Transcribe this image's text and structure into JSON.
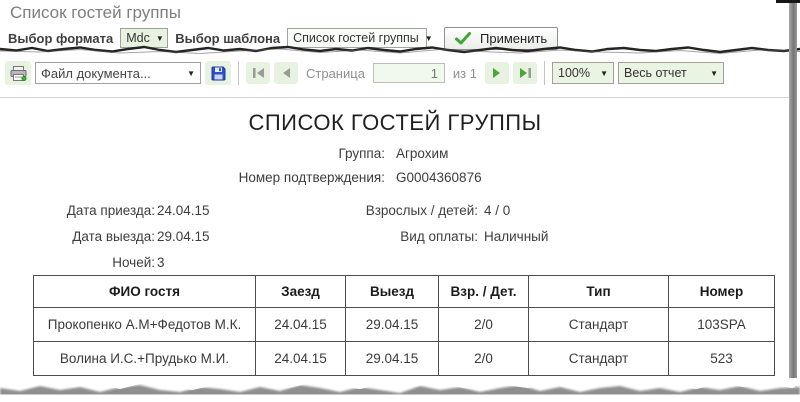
{
  "page": {
    "title": "Список гостей группы"
  },
  "format_bar": {
    "format_label": "Выбор формата",
    "format_value": "Mdc",
    "template_label": "Выбор шаблона",
    "template_value": "Список гостей группы",
    "apply_label": "Применить"
  },
  "toolbar": {
    "file_menu_value": "Файл документа...",
    "page_label": "Страница",
    "page_value": "1",
    "page_total": "из 1",
    "zoom_value": "100%",
    "view_value": "Весь отчет"
  },
  "report": {
    "title": "СПИСОК ГОСТЕЙ ГРУППЫ",
    "fields": {
      "group_label": "Группа:",
      "group_value": "Агрохим",
      "confirmation_label": "Номер подтверждения:",
      "confirmation_value": "G0004360876",
      "arrival_label": "Дата приезда:",
      "arrival_value": "24.04.15",
      "departure_label": "Дата выезда:",
      "departure_value": "29.04.15",
      "nights_label": "Ночей:",
      "nights_value": "3",
      "adults_label": "Взрослых / детей:",
      "adults_value": "4 / 0",
      "payment_label": "Вид оплаты:",
      "payment_value": "Наличный"
    },
    "table": {
      "headers": [
        "ФИО гостя",
        "Заезд",
        "Выезд",
        "Взр. / Дет.",
        "Тип",
        "Номер"
      ],
      "rows": [
        [
          "Прокопенко А.М+Федотов М.К.",
          "24.04.15",
          "29.04.15",
          "2/0",
          "Стандарт",
          "103SPA"
        ],
        [
          "Волина И.С.+Прудько М.И.",
          "24.04.15",
          "29.04.15",
          "2/0",
          "Стандарт",
          "523"
        ]
      ]
    }
  },
  "icons": {
    "printer": "printer-icon",
    "save": "save-icon",
    "first_page": "first-page-icon",
    "prev_page": "prev-page-icon",
    "next_page": "next-page-icon",
    "last_page": "last-page-icon",
    "check": "check-icon",
    "caret": "caret-down-icon"
  },
  "colors": {
    "accent_green": "#3fa535",
    "tile_green": "#e8f2e0",
    "select_green": "#e9f2e1",
    "title_gray": "#7e7e7e",
    "border_dark": "#4e4e4e",
    "save_blue": "#2d51c4",
    "disabled_gray": "#9a9a9a"
  }
}
